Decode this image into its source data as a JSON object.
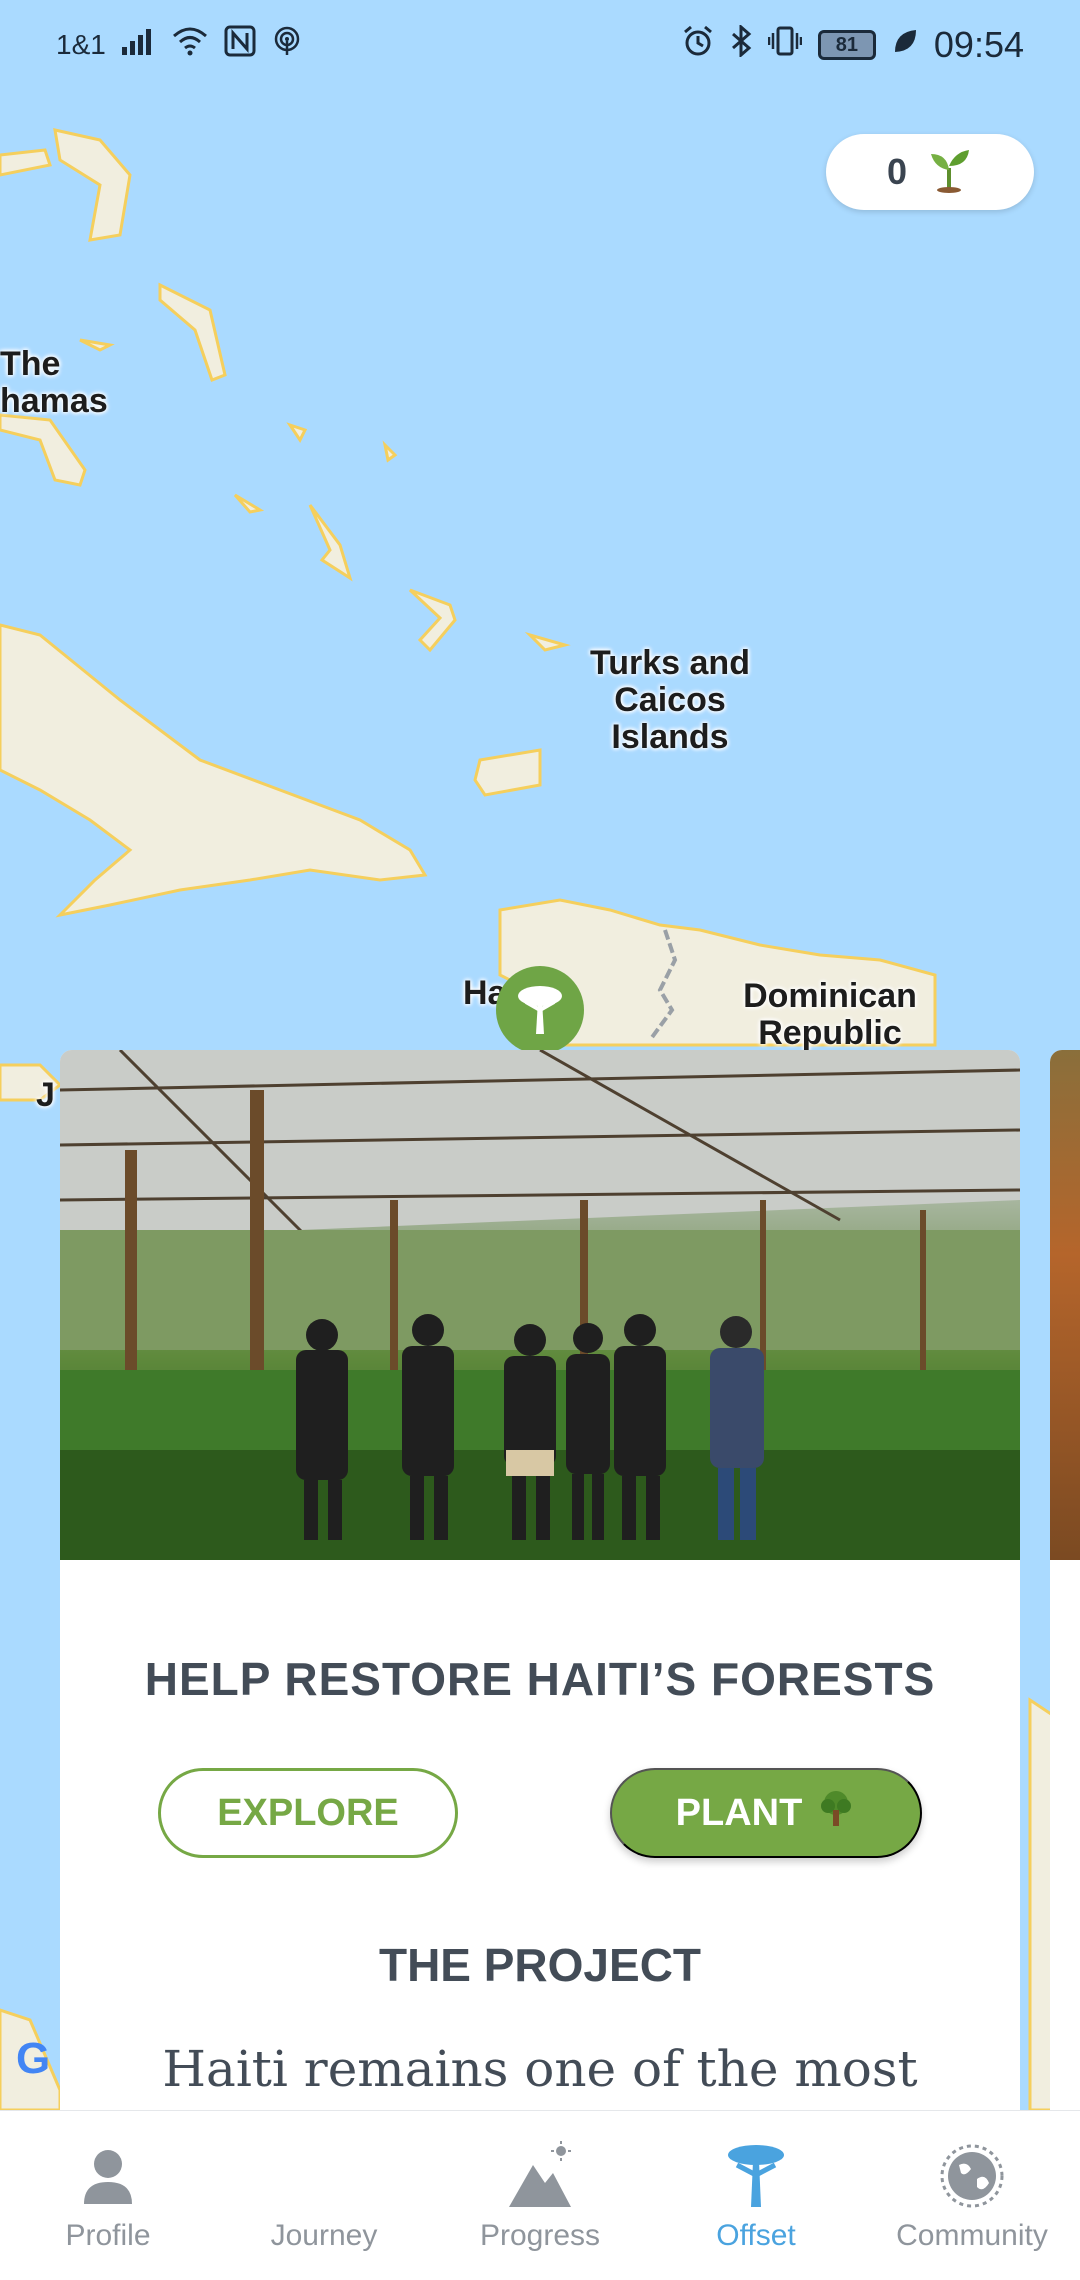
{
  "status_bar": {
    "carrier": "1&1",
    "battery": "81",
    "time": "09:54",
    "icons": [
      "signal-icon",
      "wifi-icon",
      "nfc-icon",
      "hotspot-icon",
      "alarm-icon",
      "bluetooth-icon",
      "vibrate-icon",
      "battery-icon",
      "leaf-icon"
    ]
  },
  "seed_counter": {
    "count": "0",
    "icon": "seedling-icon"
  },
  "map": {
    "labels": {
      "bahamas_line1": "The",
      "bahamas_line2": "hamas",
      "turks_line1": "Turks and",
      "turks_line2": "Caicos",
      "turks_line3": "Islands",
      "dr_line1": "Dominican",
      "dr_line2": "Republic",
      "haiti_partial": "Ha",
      "jamaica_partial": "J"
    },
    "google_logo": "G"
  },
  "card": {
    "title": "HELP RESTORE HAITI’S FORESTS",
    "explore_label": "EXPLORE",
    "plant_label": "PLANT",
    "plant_icon": "🌳",
    "section_title": "THE PROJECT",
    "section_body": "Haiti remains one of the most"
  },
  "bottom_nav": {
    "items": [
      {
        "label": "Profile",
        "icon": "person-icon"
      },
      {
        "label": "Journey",
        "icon": "journey-icon"
      },
      {
        "label": "Progress",
        "icon": "mountain-icon"
      },
      {
        "label": "Offset",
        "icon": "tree-icon",
        "active": true
      },
      {
        "label": "Community",
        "icon": "globe-icon"
      }
    ]
  },
  "colors": {
    "accent_green": "#76a845",
    "active_blue": "#4aa3df",
    "text_dark": "#434c57",
    "water": "#aadaff",
    "land": "#f1eedf"
  }
}
